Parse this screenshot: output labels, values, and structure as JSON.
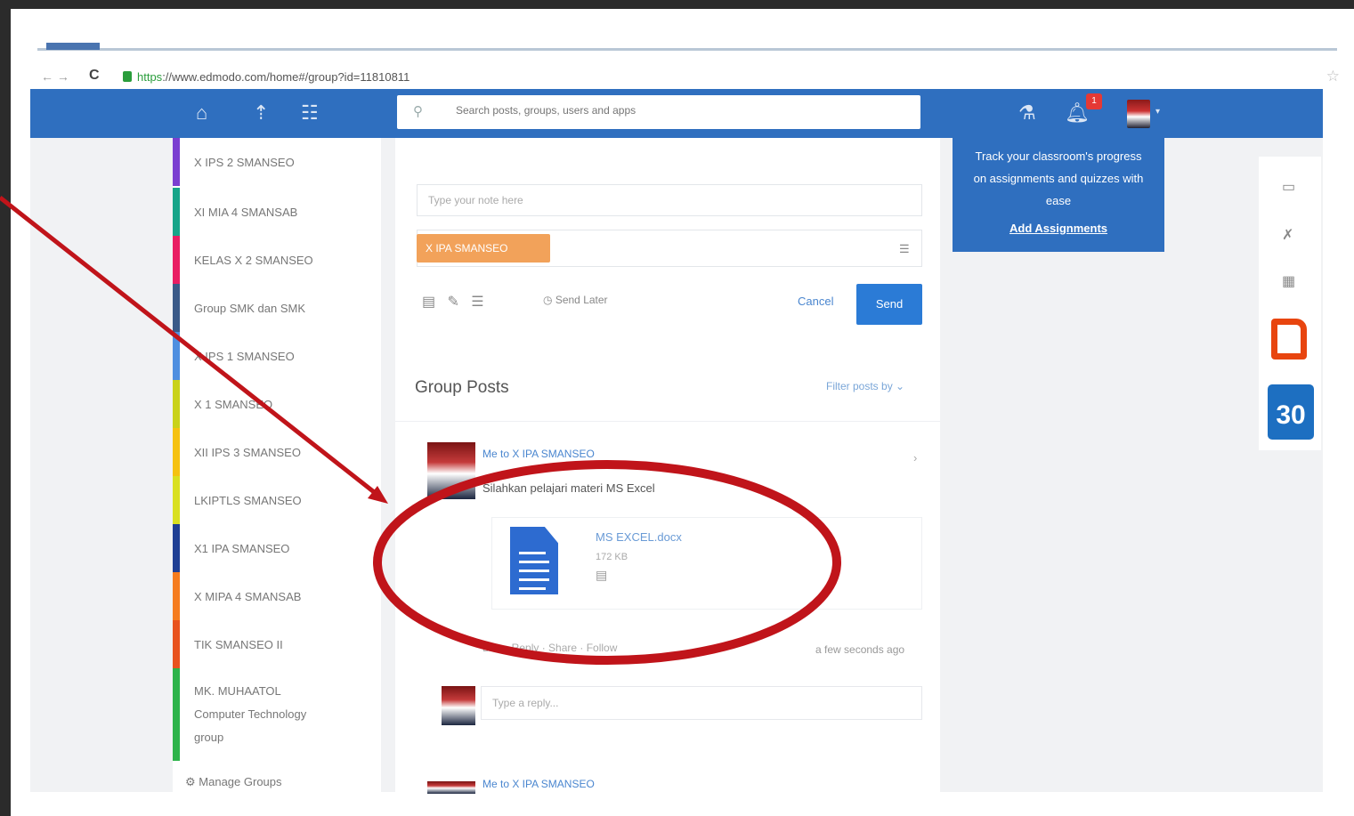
{
  "browser": {
    "url_protocol": "https",
    "url_host": "://www.edmodo.com",
    "url_path": "/home#/group?id=11810811",
    "reload_icon": "C"
  },
  "topbar": {
    "search_placeholder": "Search posts, groups, users and apps",
    "notification_count": "1"
  },
  "sidebar": {
    "items": [
      {
        "label": "X IPS 2 SMANSEO",
        "color": "#7b3fd1"
      },
      {
        "label": "XI MIA 4 SMANSAB",
        "color": "#17a589"
      },
      {
        "label": "KELAS X 2 SMANSEO",
        "color": "#e91e63"
      },
      {
        "label": "Group SMK dan SMK",
        "color": "#3a5a88"
      },
      {
        "label": "X IPS 1 SMANSEO",
        "color": "#4f8fe0"
      },
      {
        "label": "X 1 SMANSEO",
        "color": "#c9d21a"
      },
      {
        "label": "XII IPS 3 SMANSEO",
        "color": "#f5c211"
      },
      {
        "label": "LKIPTLS SMANSEO",
        "color": "#d9e021"
      },
      {
        "label": "X1 IPA SMANSEO",
        "color": "#1f3f94"
      },
      {
        "label": "X MIPA 4 SMANSAB",
        "color": "#f57c1f"
      },
      {
        "label": "TIK SMANSEO II",
        "color": "#e8531f"
      },
      {
        "label": "MK. MUHAATOL Computer Technology group",
        "color": "#2db34a"
      }
    ],
    "manage_label": "Manage Groups"
  },
  "compose": {
    "title_placeholder": "Type your note here",
    "group_chip": "X IPA SMANSEO",
    "schedule_label": "Send Later",
    "cancel_label": "Cancel",
    "send_label": "Send"
  },
  "posts": {
    "heading": "Group Posts",
    "filter_label": "Filter posts by",
    "post1": {
      "meta": "Me to X IPA SMANSEO",
      "text": "Silahkan pelajari materi MS Excel",
      "file_name": "MS EXCEL.docx",
      "file_size": "172 KB",
      "actions": "Like · Reply · Share · Follow",
      "time": "a few seconds ago",
      "reply_placeholder": "Type a reply..."
    },
    "post2": {
      "meta": "Me to X IPA SMANSEO"
    }
  },
  "promo": {
    "text": "Track your classroom's progress on assignments and quizzes with ease",
    "link": "Add Assignments"
  },
  "apps": {
    "calendar_day": "30"
  },
  "annotation_color": "#c0141a"
}
